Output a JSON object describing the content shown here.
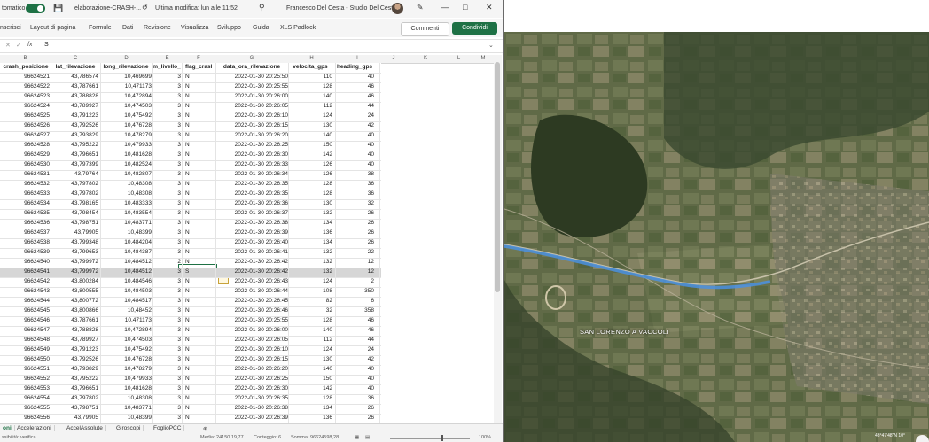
{
  "titlebar": {
    "autosave": "tomatico",
    "filename": "elaborazione-CRASH-...",
    "modified": "Ultima modifica: lun alle 11:52",
    "user": "Francesco Del Cesta - Studio Del Cesta"
  },
  "ribbon": {
    "tabs": [
      "nserisci",
      "Layout di pagina",
      "Formule",
      "Dati",
      "Revisione",
      "Visualizza",
      "Sviluppo",
      "Guida",
      "XLS Padlock"
    ],
    "comments": "Commenti",
    "share": "Condividi"
  },
  "formula": {
    "fx": "fx",
    "value": "S"
  },
  "columns": [
    "B",
    "C",
    "D",
    "E",
    "F",
    "G",
    "H",
    "I",
    "J",
    "K",
    "L",
    "M"
  ],
  "headers": [
    "crash_posizione",
    "lat_rilevazione",
    "long_rilevazione",
    "m_livello_",
    "flag_crash",
    "data_ora_rilevazione",
    "velocita_gps",
    "heading_gps"
  ],
  "rows": [
    [
      "96624521",
      "43,786574",
      "10,469699",
      "3",
      "N",
      "2022-01-30 20:25:50",
      "110",
      "40"
    ],
    [
      "96624522",
      "43,787661",
      "10,471173",
      "3",
      "N",
      "2022-01-30 20:25:55",
      "128",
      "46"
    ],
    [
      "96624523",
      "43,788828",
      "10,472894",
      "3",
      "N",
      "2022-01-30 20:26:00",
      "140",
      "46"
    ],
    [
      "96624524",
      "43,789927",
      "10,474503",
      "3",
      "N",
      "2022-01-30 20:26:05",
      "112",
      "44"
    ],
    [
      "96624525",
      "43,791223",
      "10,475492",
      "3",
      "N",
      "2022-01-30 20:26:10",
      "124",
      "24"
    ],
    [
      "96624526",
      "43,792526",
      "10,476728",
      "3",
      "N",
      "2022-01-30 20:26:15",
      "130",
      "42"
    ],
    [
      "96624527",
      "43,793829",
      "10,478279",
      "3",
      "N",
      "2022-01-30 20:26:20",
      "140",
      "40"
    ],
    [
      "96624528",
      "43,795222",
      "10,479933",
      "3",
      "N",
      "2022-01-30 20:26:25",
      "150",
      "40"
    ],
    [
      "96624529",
      "43,796651",
      "10,481628",
      "3",
      "N",
      "2022-01-30 20:26:30",
      "142",
      "40"
    ],
    [
      "96624530",
      "43,797399",
      "10,482524",
      "3",
      "N",
      "2022-01-30 20:26:33",
      "126",
      "40"
    ],
    [
      "96624531",
      "43,79764",
      "10,482807",
      "3",
      "N",
      "2022-01-30 20:26:34",
      "126",
      "38"
    ],
    [
      "96624532",
      "43,797802",
      "10,48308",
      "3",
      "N",
      "2022-01-30 20:26:35",
      "128",
      "36"
    ],
    [
      "96624533",
      "43,797802",
      "10,48308",
      "3",
      "N",
      "2022-01-30 20:26:35",
      "128",
      "36"
    ],
    [
      "96624534",
      "43,798165",
      "10,483333",
      "3",
      "N",
      "2022-01-30 20:26:36",
      "130",
      "32"
    ],
    [
      "96624535",
      "43,798454",
      "10,483554",
      "3",
      "N",
      "2022-01-30 20:26:37",
      "132",
      "26"
    ],
    [
      "96624536",
      "43,798751",
      "10,483771",
      "3",
      "N",
      "2022-01-30 20:26:38",
      "134",
      "26"
    ],
    [
      "96624537",
      "43,79905",
      "10,48399",
      "3",
      "N",
      "2022-01-30 20:26:39",
      "136",
      "26"
    ],
    [
      "96624538",
      "43,799348",
      "10,484204",
      "3",
      "N",
      "2022-01-30 20:26:40",
      "134",
      "26"
    ],
    [
      "96624539",
      "43,799653",
      "10,484387",
      "3",
      "N",
      "2022-01-30 20:26:41",
      "132",
      "22"
    ],
    [
      "96624540",
      "43,799972",
      "10,484512",
      "2",
      "N",
      "2022-01-30 20:26:42",
      "132",
      "12"
    ],
    [
      "96624541",
      "43,799972",
      "10,484512",
      "3",
      "S",
      "2022-01-30 20:26:42",
      "132",
      "12"
    ],
    [
      "96624542",
      "43,800284",
      "10,484546",
      "3",
      "N",
      "2022-01-30 20:26:43",
      "124",
      "2"
    ],
    [
      "96624543",
      "43,800555",
      "10,484503",
      "3",
      "N",
      "2022-01-30 20:26:44",
      "108",
      "350"
    ],
    [
      "96624544",
      "43,800772",
      "10,484517",
      "3",
      "N",
      "2022-01-30 20:26:45",
      "82",
      "6"
    ],
    [
      "96624545",
      "43,800866",
      "10,48452",
      "3",
      "N",
      "2022-01-30 20:26:46",
      "32",
      "358"
    ],
    [
      "96624546",
      "43,787661",
      "10,471173",
      "3",
      "N",
      "2022-01-30 20:25:55",
      "128",
      "46"
    ],
    [
      "96624547",
      "43,788828",
      "10,472894",
      "3",
      "N",
      "2022-01-30 20:26:00",
      "140",
      "46"
    ],
    [
      "96624548",
      "43,789927",
      "10,474503",
      "3",
      "N",
      "2022-01-30 20:26:05",
      "112",
      "44"
    ],
    [
      "96624549",
      "43,791223",
      "10,475492",
      "3",
      "N",
      "2022-01-30 20:26:10",
      "124",
      "24"
    ],
    [
      "96624550",
      "43,792526",
      "10,476728",
      "3",
      "N",
      "2022-01-30 20:26:15",
      "130",
      "42"
    ],
    [
      "96624551",
      "43,793829",
      "10,478279",
      "3",
      "N",
      "2022-01-30 20:26:20",
      "140",
      "40"
    ],
    [
      "96624552",
      "43,795222",
      "10,479933",
      "3",
      "N",
      "2022-01-30 20:26:25",
      "150",
      "40"
    ],
    [
      "96624553",
      "43,796651",
      "10,481628",
      "3",
      "N",
      "2022-01-30 20:26:30",
      "142",
      "40"
    ],
    [
      "96624554",
      "43,797802",
      "10,48308",
      "3",
      "N",
      "2022-01-30 20:26:35",
      "128",
      "36"
    ],
    [
      "96624555",
      "43,798751",
      "10,483771",
      "3",
      "N",
      "2022-01-30 20:26:38",
      "134",
      "26"
    ],
    [
      "96624556",
      "43,79905",
      "10,48399",
      "3",
      "N",
      "2022-01-30 20:26:39",
      "136",
      "26"
    ]
  ],
  "selected_row": 20,
  "sheets": [
    "oni",
    "Accelerazioni",
    "AccelAssolute",
    "Giroscopi",
    "FoglioPCC"
  ],
  "active_sheet": 0,
  "status": {
    "left": "ssibilità: verifica",
    "media": "Media: 24150.19,77",
    "conteggio": "Conteggio: 6",
    "somma": "Somma: 96624598,28",
    "zoom": "100%"
  },
  "map": {
    "label": "SAN LORENZO A VACCOLI",
    "coords": "43°47'48\"N 10°"
  }
}
